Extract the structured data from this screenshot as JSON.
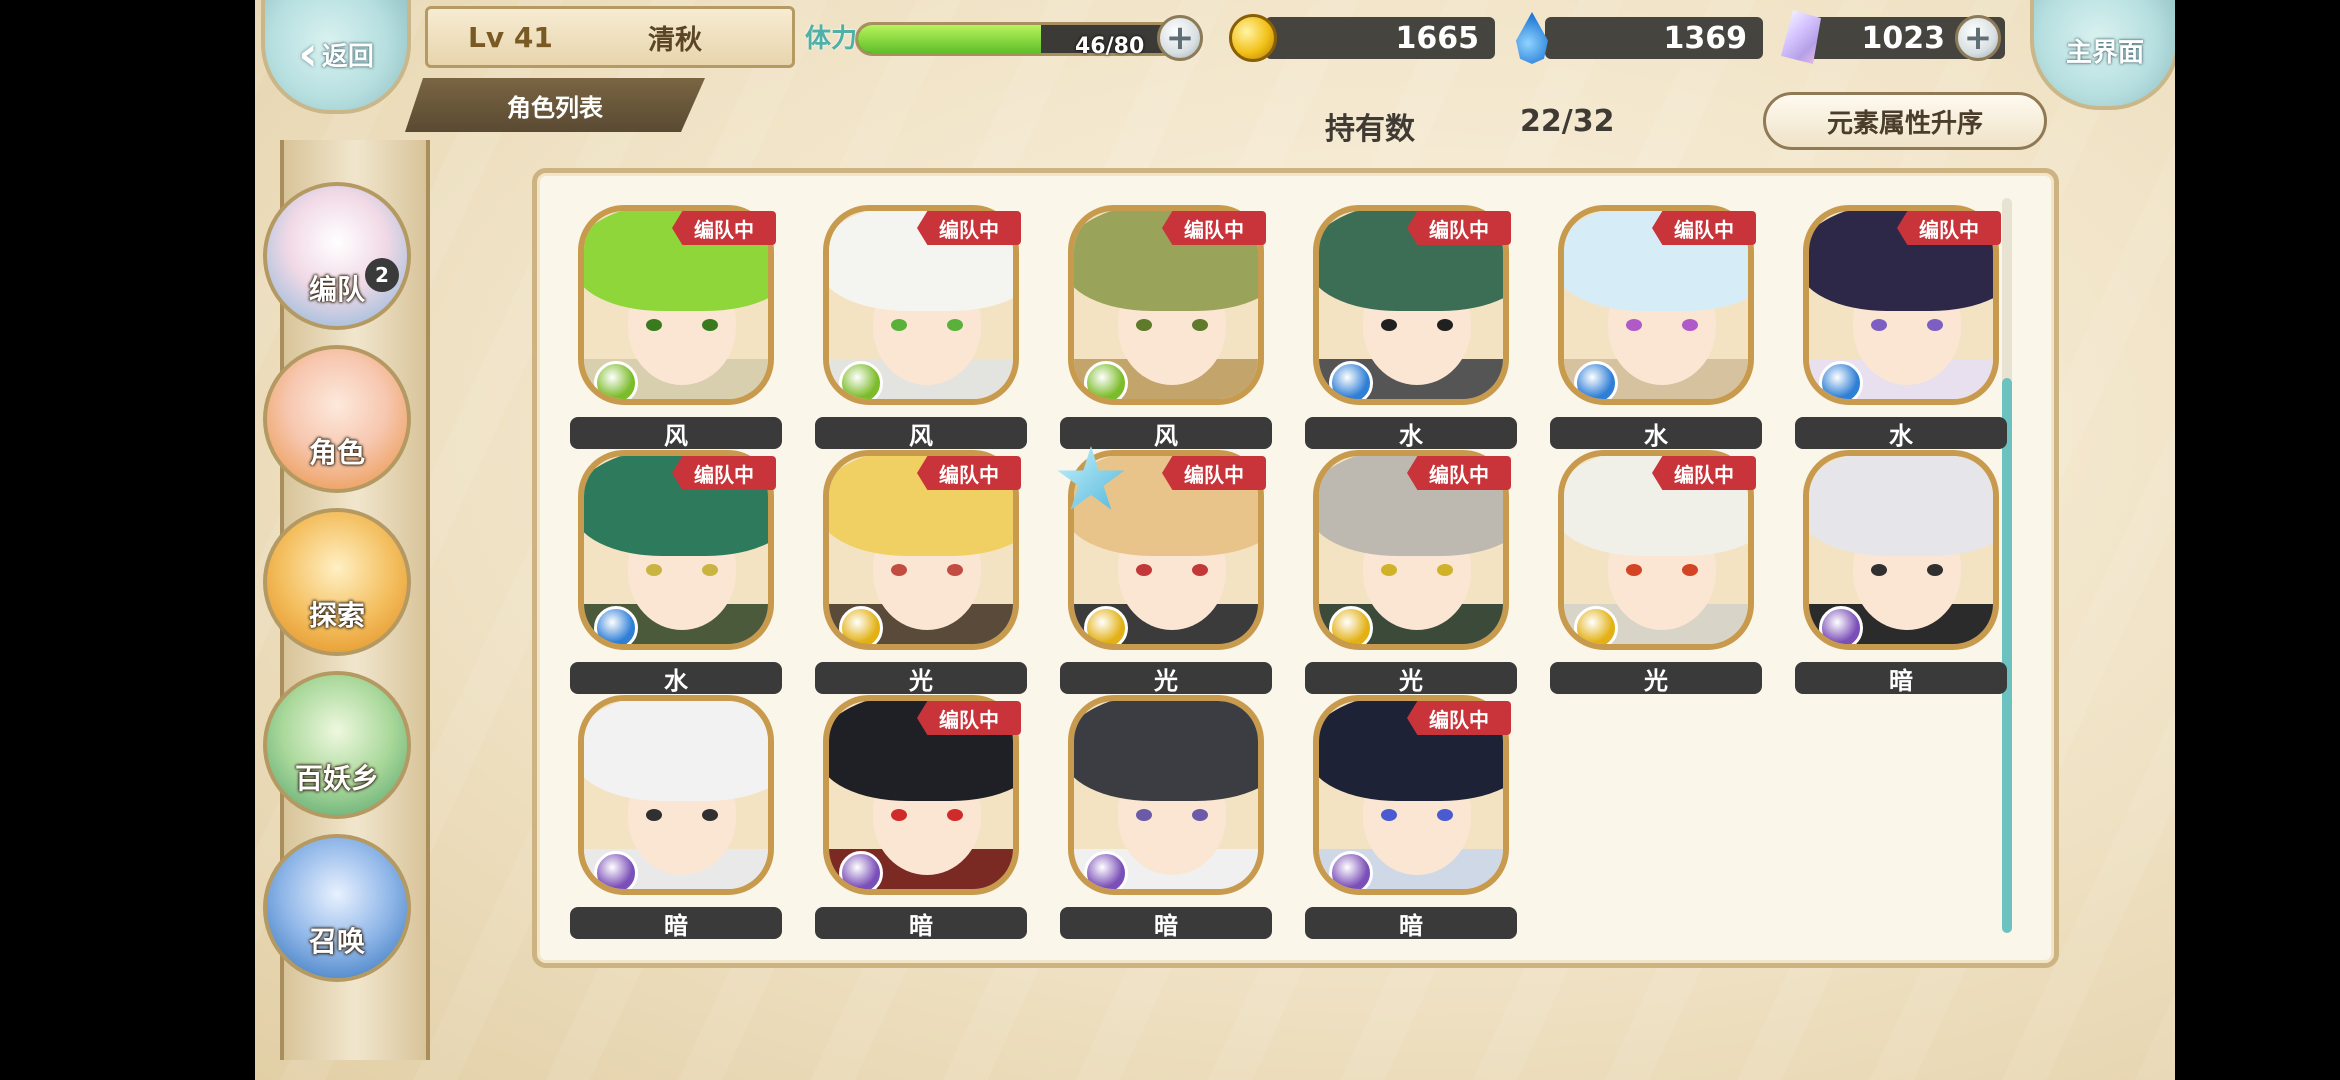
{
  "header": {
    "back_label": "返回",
    "level": "Lv 41",
    "player_name": "清秋",
    "tab_label": "角色列表",
    "stamina_label": "体力",
    "stamina_text": "46/80",
    "stamina_fraction": 0.575,
    "gold": "1665",
    "water_gems": "1369",
    "crystals": "1023",
    "home_label": "主界面"
  },
  "summary": {
    "owned_label": "持有数",
    "owned_count": "22/32",
    "sort_label": "元素属性升序"
  },
  "side_menu": {
    "items": [
      {
        "label": "编队",
        "badge": "2",
        "color": "#f1d9e6"
      },
      {
        "label": "角色",
        "badge": "",
        "color": "#f7c7b0"
      },
      {
        "label": "探索",
        "badge": "",
        "color": "#f4c061"
      },
      {
        "label": "百妖乡",
        "badge": "",
        "color": "#a9d89a"
      },
      {
        "label": "召唤",
        "badge": "",
        "color": "#8fb6e8"
      }
    ]
  },
  "team_tag": "编队中",
  "characters": [
    {
      "element": "风",
      "in_team": true,
      "hair": "#8ed63a",
      "eye": "#3a7a1f",
      "elem_color": "#7cbc2a",
      "bottom": "#d8cfae"
    },
    {
      "element": "风",
      "in_team": true,
      "hair": "#f4f4f0",
      "eye": "#5ab13a",
      "elem_color": "#7cbc2a",
      "bottom": "#e3e3e0"
    },
    {
      "element": "风",
      "in_team": true,
      "hair": "#9aa35a",
      "eye": "#5e7a2a",
      "elem_color": "#7cbc2a",
      "bottom": "#c3a46b"
    },
    {
      "element": "水",
      "in_team": true,
      "hair": "#3c6e56",
      "eye": "#202020",
      "elem_color": "#2f7fd6",
      "bottom": "#555555"
    },
    {
      "element": "水",
      "in_team": true,
      "hair": "#d6ecf6",
      "eye": "#b05ac8",
      "elem_color": "#2f7fd6",
      "bottom": "#d7c2a0"
    },
    {
      "element": "水",
      "in_team": true,
      "hair": "#2d2848",
      "eye": "#7d5fc2",
      "elem_color": "#2f7fd6",
      "bottom": "#e8e0ef"
    },
    {
      "element": "水",
      "in_team": true,
      "hair": "#2d7a5c",
      "eye": "#c9b441",
      "elem_color": "#2f7fd6",
      "bottom": "#4a5a3a"
    },
    {
      "element": "光",
      "in_team": true,
      "hair": "#f0cf63",
      "eye": "#c24b42",
      "elem_color": "#e3b115",
      "bottom": "#5a4a3a"
    },
    {
      "element": "光",
      "in_team": true,
      "hair": "#e8c48a",
      "eye": "#c23838",
      "elem_color": "#e3b115",
      "bottom": "#3b3b3b",
      "star": true
    },
    {
      "element": "光",
      "in_team": true,
      "hair": "#bdb8b0",
      "eye": "#d0b22a",
      "elem_color": "#e3b115",
      "bottom": "#3c4a3a"
    },
    {
      "element": "光",
      "in_team": true,
      "hair": "#f0efe8",
      "eye": "#d24424",
      "elem_color": "#e3b115",
      "bottom": "#d9d4c8"
    },
    {
      "element": "暗",
      "in_team": false,
      "hair": "#e6e6ea",
      "eye": "#303030",
      "elem_color": "#7b4fb8",
      "bottom": "#2b2b2b"
    },
    {
      "element": "暗",
      "in_team": false,
      "hair": "#f2f2f2",
      "eye": "#303030",
      "elem_color": "#7b4fb8",
      "bottom": "#e9e9e9"
    },
    {
      "element": "暗",
      "in_team": true,
      "hair": "#1f1f26",
      "eye": "#d12a2a",
      "elem_color": "#7b4fb8",
      "bottom": "#7a2a22"
    },
    {
      "element": "暗",
      "in_team": false,
      "hair": "#3b3d42",
      "eye": "#6a5aa8",
      "elem_color": "#7b4fb8",
      "bottom": "#f0f0f0"
    },
    {
      "element": "暗",
      "in_team": true,
      "hair": "#1d2236",
      "eye": "#4a5ad0",
      "elem_color": "#7b4fb8",
      "bottom": "#cfd8e6"
    }
  ]
}
